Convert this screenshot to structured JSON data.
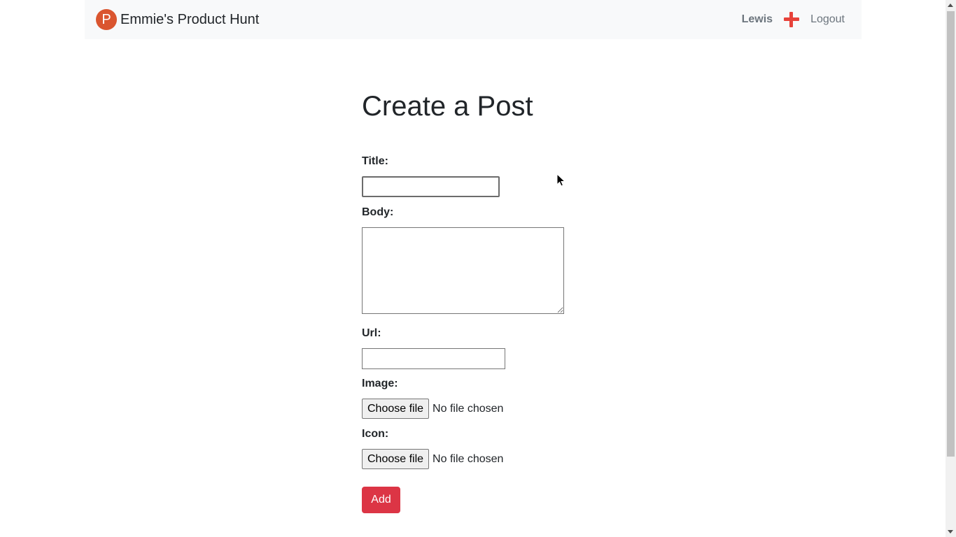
{
  "navbar": {
    "brand_logo_letter": "P",
    "brand_name": "Emmie's Product Hunt",
    "user_name": "Lewis",
    "plus_icon": "plus-icon",
    "logout_label": "Logout"
  },
  "colors": {
    "brand": "#da552f",
    "accent_plus": "#e7423a",
    "add_button": "#dc3545",
    "navbar_bg": "#f8f9fa"
  },
  "form": {
    "title": "Create a Post",
    "title_label": "Title:",
    "title_value": "",
    "body_label": "Body:",
    "body_value": "",
    "url_label": "Url:",
    "url_value": "",
    "image_label": "Image:",
    "image_button": "Choose file",
    "image_status": "No file chosen",
    "icon_label": "Icon:",
    "icon_button": "Choose file",
    "icon_status": "No file chosen",
    "submit_label": "Add"
  }
}
